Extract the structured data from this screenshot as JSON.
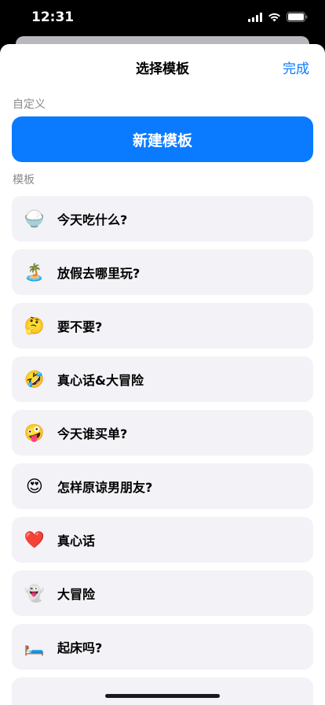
{
  "status": {
    "time": "12:31"
  },
  "nav": {
    "title": "选择模板",
    "done_label": "完成"
  },
  "custom_section": {
    "header": "自定义",
    "new_template_label": "新建模板"
  },
  "template_section": {
    "header": "模板"
  },
  "templates": [
    {
      "emoji": "🍚",
      "icon": "rice-bowl-icon",
      "label": "今天吃什么?"
    },
    {
      "emoji": "🏝️",
      "icon": "island-icon",
      "label": "放假去哪里玩?"
    },
    {
      "emoji": "🤔",
      "icon": "thinking-face-icon",
      "label": "要不要?"
    },
    {
      "emoji": "🤣",
      "icon": "rofl-face-icon",
      "label": "真心话&大冒险"
    },
    {
      "emoji": "🤪",
      "icon": "zany-face-icon",
      "label": "今天谁买单?"
    },
    {
      "emoji": "😍",
      "icon": "heart-eyes-icon",
      "label": "怎样原谅男朋友?"
    },
    {
      "emoji": "❤️",
      "icon": "red-heart-icon",
      "label": "真心话"
    },
    {
      "emoji": "👻",
      "icon": "ghost-icon",
      "label": "大冒险"
    },
    {
      "emoji": "🛏️",
      "icon": "bed-icon",
      "label": "起床吗?"
    }
  ],
  "colors": {
    "accent": "#0a7aff",
    "row_bg": "#f2f2f7",
    "section_text": "#8a8a8e"
  }
}
